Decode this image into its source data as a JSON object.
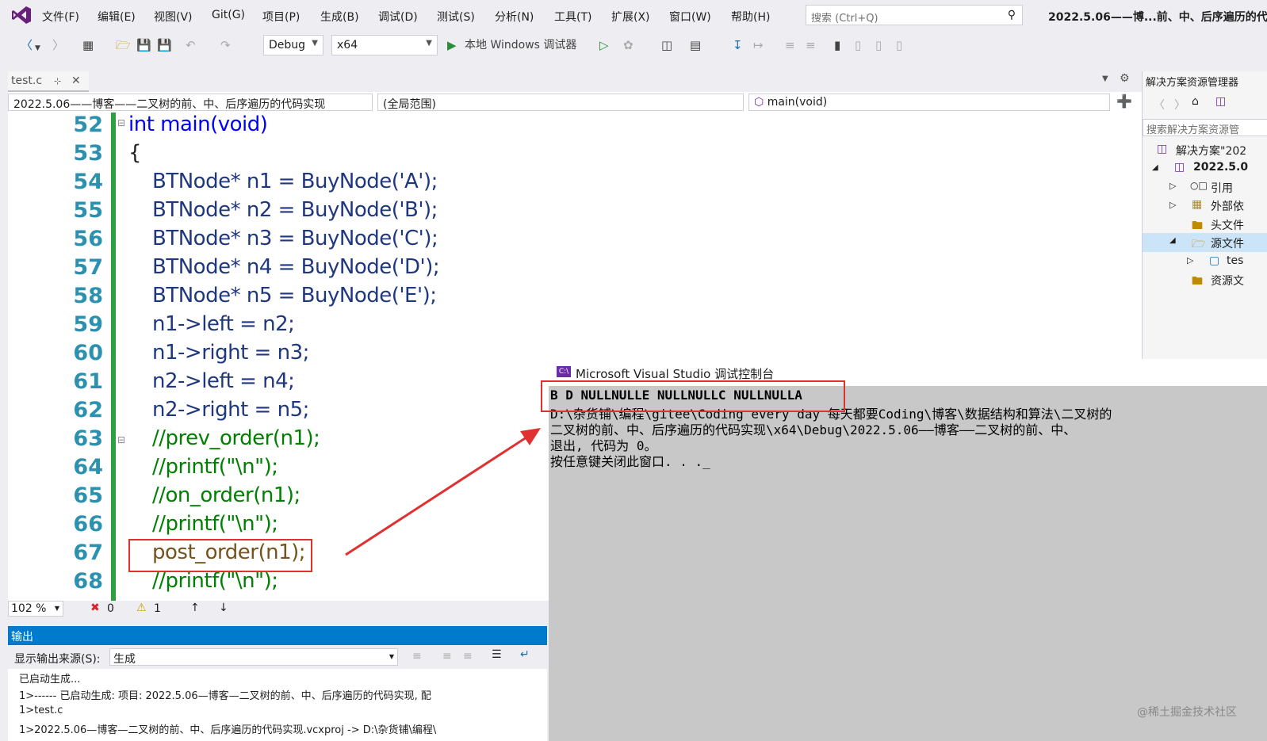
{
  "menu": {
    "items": [
      "文件(F)",
      "编辑(E)",
      "视图(V)",
      "Git(G)",
      "项目(P)",
      "生成(B)",
      "调试(D)",
      "测试(S)",
      "分析(N)",
      "工具(T)",
      "扩展(X)",
      "窗口(W)",
      "帮助(H)"
    ],
    "search_placeholder": "搜索 (Ctrl+Q)",
    "window_title": "2022.5.06——博...前、中、后序遍历的代"
  },
  "toolbar": {
    "config": "Debug",
    "platform": "x64",
    "debugger_label": "本地 Windows 调试器"
  },
  "tab": {
    "name": "test.c"
  },
  "navbar": {
    "project": "2022.5.06——博客——二叉树的前、中、后序遍历的代码实现",
    "scope": "(全局范围)",
    "member": "main(void)"
  },
  "editor": {
    "lines": [
      {
        "n": "52",
        "code": "int main(void)"
      },
      {
        "n": "53",
        "code": "{"
      },
      {
        "n": "54",
        "code": "BTNode* n1 = BuyNode('A');"
      },
      {
        "n": "55",
        "code": "BTNode* n2 = BuyNode('B');"
      },
      {
        "n": "56",
        "code": "BTNode* n3 = BuyNode('C');"
      },
      {
        "n": "57",
        "code": "BTNode* n4 = BuyNode('D');"
      },
      {
        "n": "58",
        "code": "BTNode* n5 = BuyNode('E');"
      },
      {
        "n": "59",
        "code": "n1->left = n2;"
      },
      {
        "n": "60",
        "code": "n1->right = n3;"
      },
      {
        "n": "61",
        "code": "n2->left = n4;"
      },
      {
        "n": "62",
        "code": "n2->right = n5;"
      },
      {
        "n": "63",
        "code": "//prev_order(n1);"
      },
      {
        "n": "64",
        "code": "//printf(\"\\n\");"
      },
      {
        "n": "65",
        "code": "//on_order(n1);"
      },
      {
        "n": "66",
        "code": "//printf(\"\\n\");"
      },
      {
        "n": "67",
        "code": "post_order(n1);"
      },
      {
        "n": "68",
        "code": "//printf(\"\\n\");"
      }
    ]
  },
  "status": {
    "zoom": "102 %",
    "errors": "0",
    "warnings": "1"
  },
  "output": {
    "title": "输出",
    "source_label": "显示输出来源(S):",
    "source_value": "生成",
    "lines": [
      "已启动生成...",
      "1>------ 已启动生成: 项目: 2022.5.06—博客—二叉树的前、中、后序遍历的代码实现, 配",
      "1>test.c",
      "1>2022.5.06—博客—二叉树的前、中、后序遍历的代码实现.vcxproj -> D:\\杂货铺\\编程\\"
    ]
  },
  "console": {
    "title": "Microsoft Visual Studio 调试控制台",
    "lines": [
      "B D NULLNULLE NULLNULLC NULLNULLA",
      "D:\\杂货铺\\编程\\gitee\\Coding every day 每天都要Coding\\博客\\数据结构和算法\\二叉树的",
      "二叉树的前、中、后序遍历的代码实现\\x64\\Debug\\2022.5.06——博客——二叉树的前、中、",
      "退出, 代码为 0。",
      "按任意键关闭此窗口. . ._"
    ]
  },
  "solution_explorer": {
    "title": "解决方案资源管理器",
    "search_placeholder": "搜索解决方案资源管",
    "items": [
      "解决方案\"202",
      "2022.5.0",
      "引用",
      "外部依",
      "头文件",
      "源文件",
      "tes",
      "资源文"
    ]
  },
  "watermark": "@稀土掘金技术社区",
  "colors": {
    "accent": "#007acc",
    "highlight_red": "#e03030",
    "change_bar": "#2ea043"
  }
}
